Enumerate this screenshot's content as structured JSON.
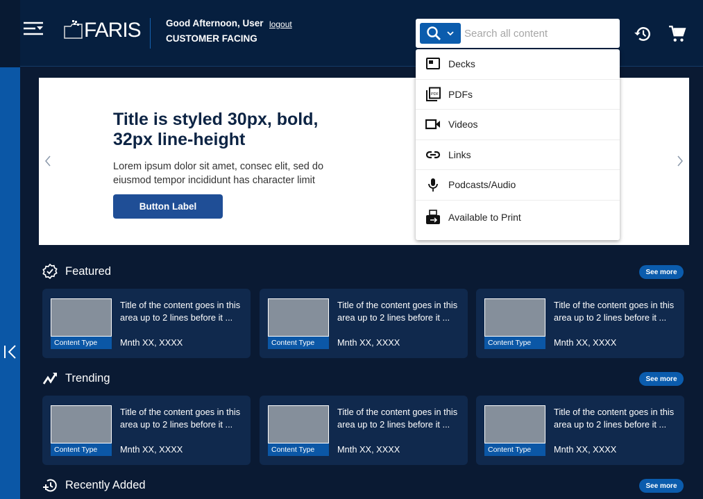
{
  "colors": {
    "header": "#061f3f",
    "page": "#0a1a33",
    "rail": "#0b57a6",
    "accent": "#0b5cad",
    "card": "#10294d",
    "hero_button": "#1f4e96"
  },
  "header": {
    "logo_text": "FARIS",
    "greeting": "Good Afternoon, User",
    "logout": "logout",
    "audience": "CUSTOMER FACING",
    "search_placeholder": "Search all content",
    "icons": [
      "menu-icon",
      "search-icon",
      "chevron-down-icon",
      "history-icon",
      "cart-icon"
    ]
  },
  "search_menu": [
    {
      "label": "Decks",
      "icon": "deck-icon"
    },
    {
      "label": "PDFs",
      "icon": "pdf-icon"
    },
    {
      "label": "Videos",
      "icon": "video-icon"
    },
    {
      "label": "Links",
      "icon": "link-icon"
    },
    {
      "label": "Podcasts/Audio",
      "icon": "microphone-icon"
    },
    {
      "label": "Available to Print",
      "icon": "print-icon"
    }
  ],
  "hero": {
    "title": "Title is styled 30px, bold, 32px line-height",
    "description": "Lorem ipsum dolor sit amet, consec elit, sed do eiusmod tempor incididunt has character limit",
    "button": "Button Label"
  },
  "sections": [
    {
      "title": "Featured",
      "icon": "verified-badge-icon",
      "see_more": "See more",
      "cards": [
        {
          "type": "Content Type",
          "title": "Title of the content goes in this area up to 2 lines before it ...",
          "date": "Mnth XX, XXXX"
        },
        {
          "type": "Content Type",
          "title": "Title of the content goes in this area up to 2 lines before it ...",
          "date": "Mnth XX, XXXX"
        },
        {
          "type": "Content Type",
          "title": "Title of the content goes in this area up to 2 lines before it ...",
          "date": "Mnth XX, XXXX"
        }
      ]
    },
    {
      "title": "Trending",
      "icon": "trending-icon",
      "see_more": "See more",
      "cards": [
        {
          "type": "Content Type",
          "title": "Title of the content goes in this area up to 2 lines before it ...",
          "date": "Mnth XX, XXXX"
        },
        {
          "type": "Content Type",
          "title": "Title of the content goes in this area up to 2 lines before it ...",
          "date": "Mnth XX, XXXX"
        },
        {
          "type": "Content Type",
          "title": "Title of the content goes in this area up to 2 lines before it ...",
          "date": "Mnth XX, XXXX"
        }
      ]
    },
    {
      "title": "Recently Added",
      "icon": "recently-added-icon",
      "see_more": "See more",
      "cards": []
    }
  ]
}
